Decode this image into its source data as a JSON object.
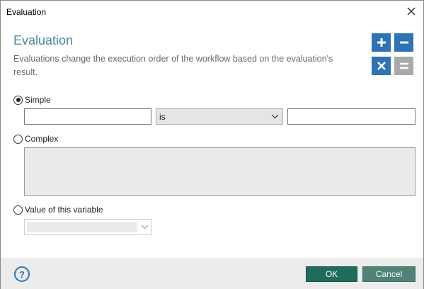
{
  "window": {
    "title": "Evaluation"
  },
  "header": {
    "heading": "Evaluation",
    "description": "Evaluations change the execution order of the workflow based on the evaluation's result."
  },
  "operators": {
    "add": "+",
    "minus": "−",
    "multiply": "X",
    "equals": "="
  },
  "simple": {
    "label": "Simple",
    "selected": true,
    "left_value": "",
    "operator": "is",
    "right_value": ""
  },
  "complex": {
    "label": "Complex",
    "selected": false,
    "expression": ""
  },
  "variable": {
    "label": "Value of this variable",
    "selected": false,
    "value": ""
  },
  "footer": {
    "help": "?",
    "ok_label": "OK",
    "cancel_label": "Cancel"
  },
  "colors": {
    "accent_blue": "#2e73b5",
    "heading_teal": "#4a8a98",
    "ok_green": "#1f6b5c",
    "cancel_green": "#4f8377"
  }
}
